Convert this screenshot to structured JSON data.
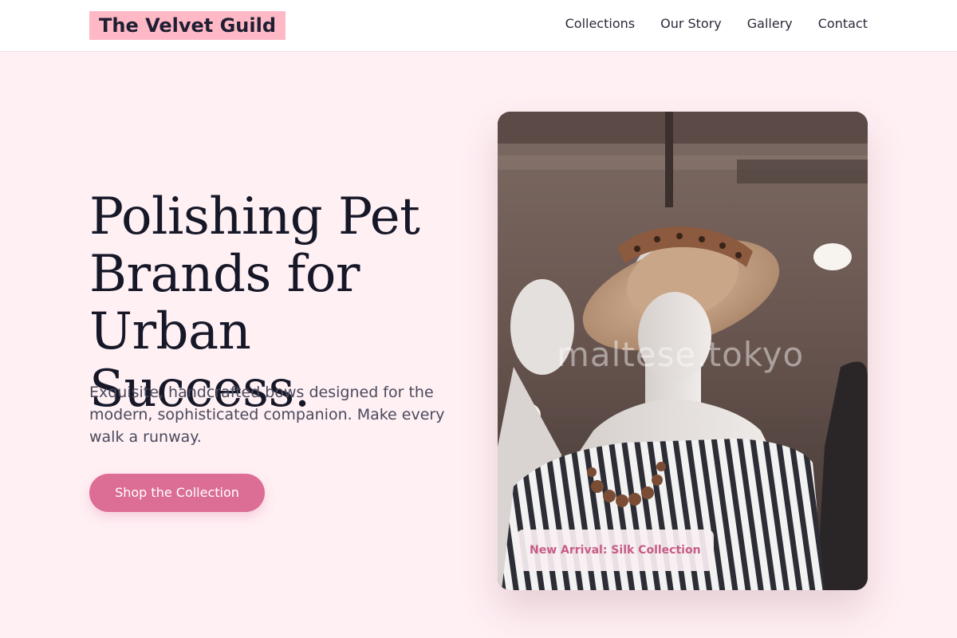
{
  "brand": {
    "name": "The Velvet Guild"
  },
  "nav": {
    "items": [
      {
        "label": "Collections"
      },
      {
        "label": "Our Story"
      },
      {
        "label": "Gallery"
      },
      {
        "label": "Contact"
      }
    ]
  },
  "hero": {
    "title": "Polishing Pet Brands for Urban Success.",
    "description": "Exquisite, handcrafted bows designed for the modern, sophisticated companion. Make every walk a runway.",
    "cta_label": "Shop the Collection"
  },
  "image": {
    "watermark": "maltese.tokyo",
    "badge": "New Arrival: Silk Collection"
  },
  "colors": {
    "accent": "#dc6d94",
    "logo_bg": "#ffb8c6",
    "background": "#fff0f4",
    "badge_text": "#c85c88"
  }
}
